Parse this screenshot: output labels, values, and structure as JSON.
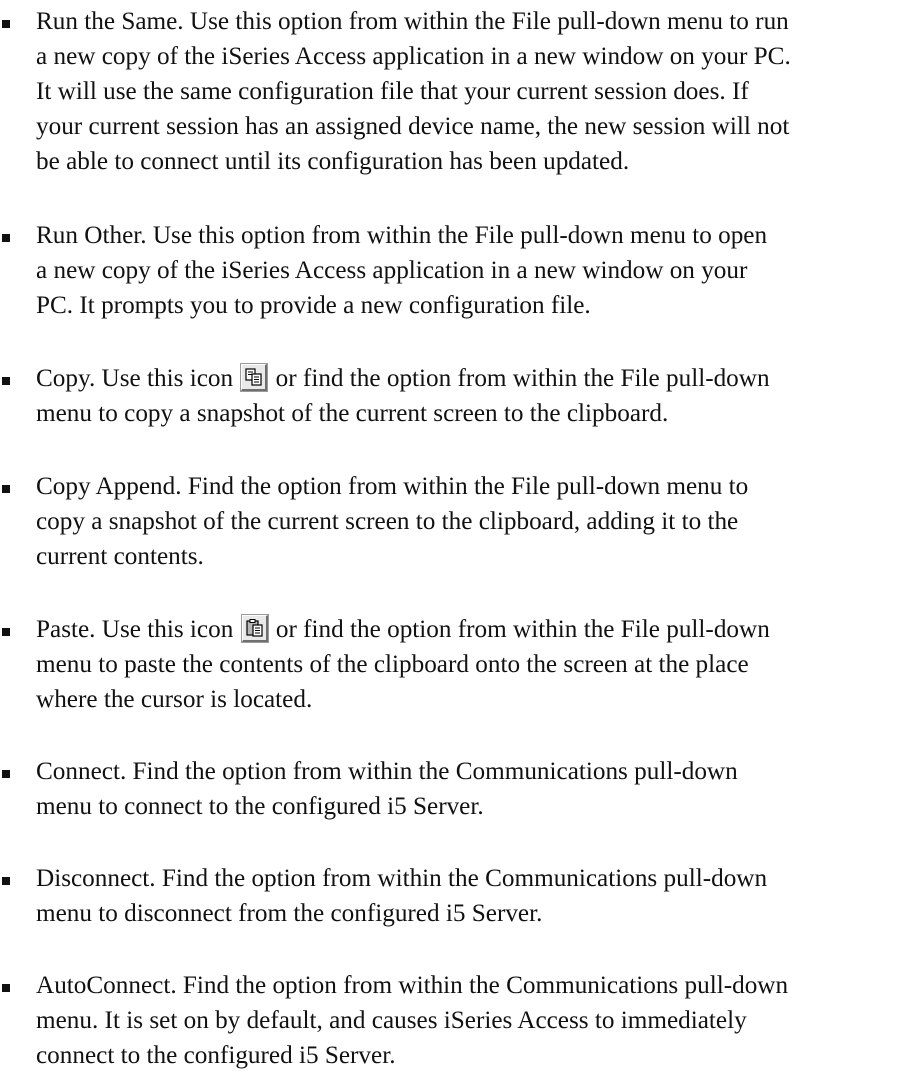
{
  "items": [
    {
      "lines": [
        "Run the Same. Use this option from within the File pull-down menu to run",
        "a new copy of the iSeries Access application in a new window on your PC.",
        "It will use the same configuration file that your current session does. If",
        "your current session has an assigned device name, the new session will not",
        "be able to connect until its configuration has been updated."
      ]
    },
    {
      "lines": [
        "Run Other. Use this option from within the File pull-down menu to open",
        "a new copy of the iSeries Access application in a new window on your",
        "PC. It prompts you to provide a new configuration file."
      ]
    },
    {
      "line1_before_icon": "Copy. Use this icon",
      "icon": "copy-icon",
      "line1_after_icon": "or find the option from within the File pull-down",
      "lines_rest": [
        "menu to copy a snapshot of the current screen to the clipboard."
      ]
    },
    {
      "lines": [
        "Copy Append. Find the option from within the File pull-down menu to",
        "copy a snapshot of the current screen to the clipboard, adding it to the",
        "current contents."
      ]
    },
    {
      "line1_before_icon": "Paste. Use this icon",
      "icon": "paste-icon",
      "line1_after_icon": "or find the option from within the File pull-down",
      "lines_rest": [
        "menu to paste the contents of the clipboard onto the screen at the place",
        "where the cursor is located."
      ]
    },
    {
      "lines": [
        "Connect. Find the option from within the Communications pull-down",
        "menu to connect to the configured i5 Server."
      ]
    },
    {
      "lines": [
        "Disconnect. Find the option from within the Communications pull-down",
        "menu to disconnect from the configured i5 Server."
      ]
    },
    {
      "lines": [
        "AutoConnect. Find the option from within the Communications pull-down",
        "menu. It is set on by default, and causes iSeries Access to immediately",
        "connect to the configured i5 Server."
      ]
    }
  ]
}
